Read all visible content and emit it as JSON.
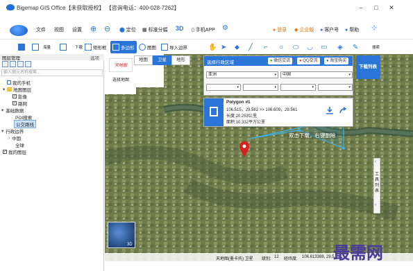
{
  "window": {
    "title": "Bigemap GIS Office【未获取授权】 【咨询电话：400-028-7262】",
    "minimize": "–",
    "maximize": "□",
    "close": "✕"
  },
  "menu": {
    "items": [
      "文件",
      "视图",
      "设置"
    ],
    "locate": "定位",
    "grid_split": "标准分幅",
    "three_d": "3D",
    "mobile_app": "手机APP",
    "login": "登录",
    "enterprise": "企业版",
    "customer_service": "客户号",
    "help": "帮助"
  },
  "toolbar": {
    "items": [
      "海量",
      "",
      "下载",
      "矩形框",
      "多边形",
      "图图",
      "导入边界"
    ],
    "active": "多边形",
    "right_label": "搜索"
  },
  "sidebar": {
    "header": "图层管理",
    "header_right": "选项",
    "search_placeholder": "输入图元名称搜索...",
    "tree": [
      {
        "label": "我的手机",
        "indent": 1,
        "type": "phone"
      },
      {
        "label": "地图图层",
        "indent": 1,
        "type": "folder",
        "toggle": "▾"
      },
      {
        "label": "影像",
        "indent": 2,
        "type": "check",
        "checked": true
      },
      {
        "label": "路网",
        "indent": 2,
        "type": "check",
        "checked": true
      },
      {
        "label": "基础数据",
        "indent": 0,
        "type": "toggle",
        "toggle": "▾"
      },
      {
        "label": "POI搜索",
        "indent": 2,
        "type": "plain"
      },
      {
        "label": "公交路线",
        "indent": 2,
        "type": "plain",
        "selected": true
      },
      {
        "label": "行政边界",
        "indent": 0,
        "type": "toggle",
        "toggle": "▾"
      },
      {
        "label": "中国",
        "indent": 1,
        "type": "toggle",
        "toggle": "›"
      },
      {
        "label": "全球",
        "indent": 2,
        "type": "plain"
      },
      {
        "label": "我的图层",
        "indent": 0,
        "type": "check",
        "checked": true
      }
    ]
  },
  "map": {
    "tabs": [
      "地图",
      "卫星",
      "地形"
    ],
    "active_tab": "卫星",
    "logo_text": "天地图",
    "select_map": "选择地图",
    "globe_label": "3D"
  },
  "region_panel": {
    "title": "选择行政区域",
    "wechat": "微信交流",
    "qq": "QQ交流",
    "taobao": "淘宝购买",
    "country": "亚洲",
    "province": "中国",
    "dropdowns": [
      "",
      "",
      "",
      ""
    ]
  },
  "download_button": "下载列表",
  "polygon_card": {
    "title": "Polygon #1",
    "coords": "106.515，29.582 >> 106.609，29.561",
    "length": "长度:20.253公里",
    "area": "面积:10.332平方公里"
  },
  "annotation": "双击下载，右键删除",
  "right_tools": "工具列表",
  "statusbar": {
    "source": "天地图(墨卡托) 卫星",
    "level_label": "级别:",
    "level": "12",
    "lon_label": "经纬度:",
    "lon": "106.613388, 29.5..."
  },
  "watermark": "最需网",
  "colors": {
    "accent": "#2b74d8",
    "polygon_stroke": "#3bb0e8",
    "marker": "#d82020"
  }
}
